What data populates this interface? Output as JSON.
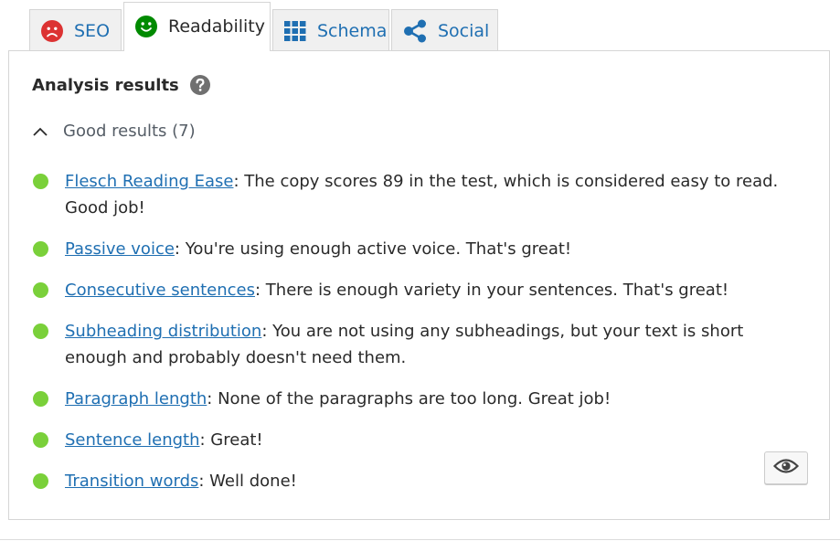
{
  "tabs": [
    {
      "label": "SEO",
      "icon": "sad-face-icon",
      "icon_color": "#dc3232",
      "active": false
    },
    {
      "label": "Readability",
      "icon": "smiley-face-icon",
      "icon_color": "#008a00",
      "active": true
    },
    {
      "label": "Schema",
      "icon": "grid-icon",
      "icon_color": "#1f6fb2",
      "active": false
    },
    {
      "label": "Social",
      "icon": "share-icon",
      "icon_color": "#1f6fb2",
      "active": false
    }
  ],
  "analysis": {
    "heading": "Analysis results",
    "help_icon": "question-circle-icon",
    "group_label": "Good results (7)",
    "group_expanded": true,
    "status_color": "#7ad03a",
    "results": [
      {
        "link": "Flesch Reading Ease",
        "text": ": The copy scores 89 in the test, which is considered easy to read. Good job!"
      },
      {
        "link": "Passive voice",
        "text": ": You're using enough active voice. That's great!"
      },
      {
        "link": "Consecutive sentences",
        "text": ": There is enough variety in your sentences. That's great!"
      },
      {
        "link": "Subheading distribution",
        "text": ": You are not using any subheadings, but your text is short enough and probably doesn't need them."
      },
      {
        "link": "Paragraph length",
        "text": ": None of the paragraphs are too long. Great job!"
      },
      {
        "link": "Sentence length",
        "text": ": Great!"
      },
      {
        "link": "Transition words",
        "text": ": Well done!"
      }
    ],
    "eye_button_icon": "eye-icon"
  },
  "colors": {
    "link": "#1f6fb2",
    "good": "#7ad03a",
    "bad": "#dc3232"
  }
}
